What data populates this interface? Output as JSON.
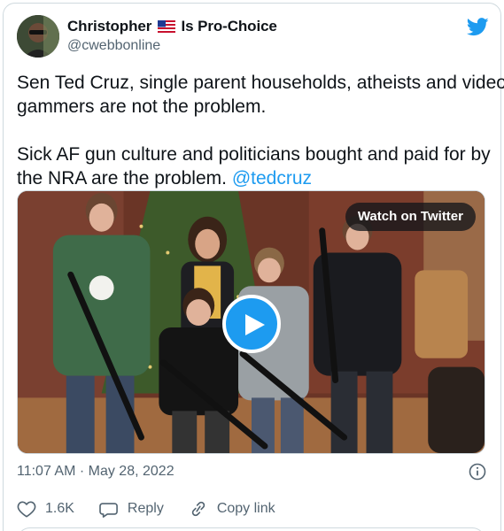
{
  "author": {
    "display_name": "Christopher",
    "flag_icon": "us-flag-icon",
    "display_name_suffix": "Is Pro-Choice",
    "handle": "@cwebbonline"
  },
  "brand": {
    "icon": "twitter-bird-icon",
    "color": "#1d9bf0"
  },
  "tweet": {
    "line1": "Sen Ted Cruz, single parent households, atheists and video",
    "line2": "gammers are not the problem.",
    "line3": "Sick AF gun culture and politicians bought and paid for by",
    "line4": "the NRA are the problem.",
    "mention": "@tedcruz"
  },
  "media": {
    "watch_label": "Watch on Twitter",
    "play_icon": "play-icon"
  },
  "meta": {
    "timestamp": "11:07 AM · May 28, 2022",
    "info_icon": "info-icon"
  },
  "actions": {
    "like_count": "1.6K",
    "reply_label": "Reply",
    "copy_label": "Copy link"
  },
  "colors": {
    "text": "#0f1419",
    "secondary": "#536471",
    "link": "#1d9bf0",
    "border": "#cfd9de"
  }
}
